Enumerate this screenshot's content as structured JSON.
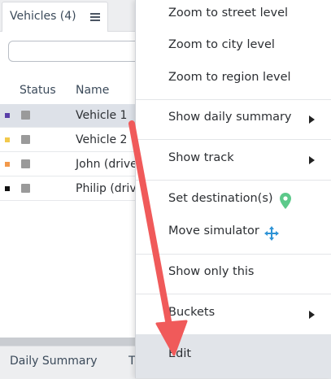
{
  "tabs": {
    "vehicles_label": "Vehicles (4)"
  },
  "search": {
    "value": "",
    "placeholder": ""
  },
  "table": {
    "columns": [
      "Status",
      "Name"
    ],
    "rows": [
      {
        "name": "Vehicle 1",
        "color": "#5a3fa8",
        "selected": true
      },
      {
        "name": "Vehicle 2",
        "color": "#f2c94c",
        "selected": false
      },
      {
        "name": "John (driver)",
        "color": "#f2994a",
        "selected": false
      },
      {
        "name": "Philip (driver)",
        "color": "#111111",
        "selected": false
      }
    ]
  },
  "bottom_tabs": [
    "Daily Summary",
    "T"
  ],
  "context_menu": {
    "items": [
      {
        "label": "Zoom to street level"
      },
      {
        "label": "Zoom to city level"
      },
      {
        "label": "Zoom to region level"
      },
      {
        "label": "Show daily summary",
        "submenu": true
      },
      {
        "label": "Show track",
        "submenu": true
      },
      {
        "label": "Set destination(s)",
        "icon": "map-pin-icon"
      },
      {
        "label": "Move simulator",
        "icon": "move-arrows-icon"
      },
      {
        "label": "Show only this"
      },
      {
        "label": "Buckets",
        "submenu": true
      },
      {
        "label": "Edit",
        "hovered": true
      }
    ]
  },
  "colors": {
    "pin_icon": "#5cc98a",
    "move_icon": "#2d93d6",
    "arrow": "#f05a5a",
    "hover_bg": "#e1e4e9"
  }
}
